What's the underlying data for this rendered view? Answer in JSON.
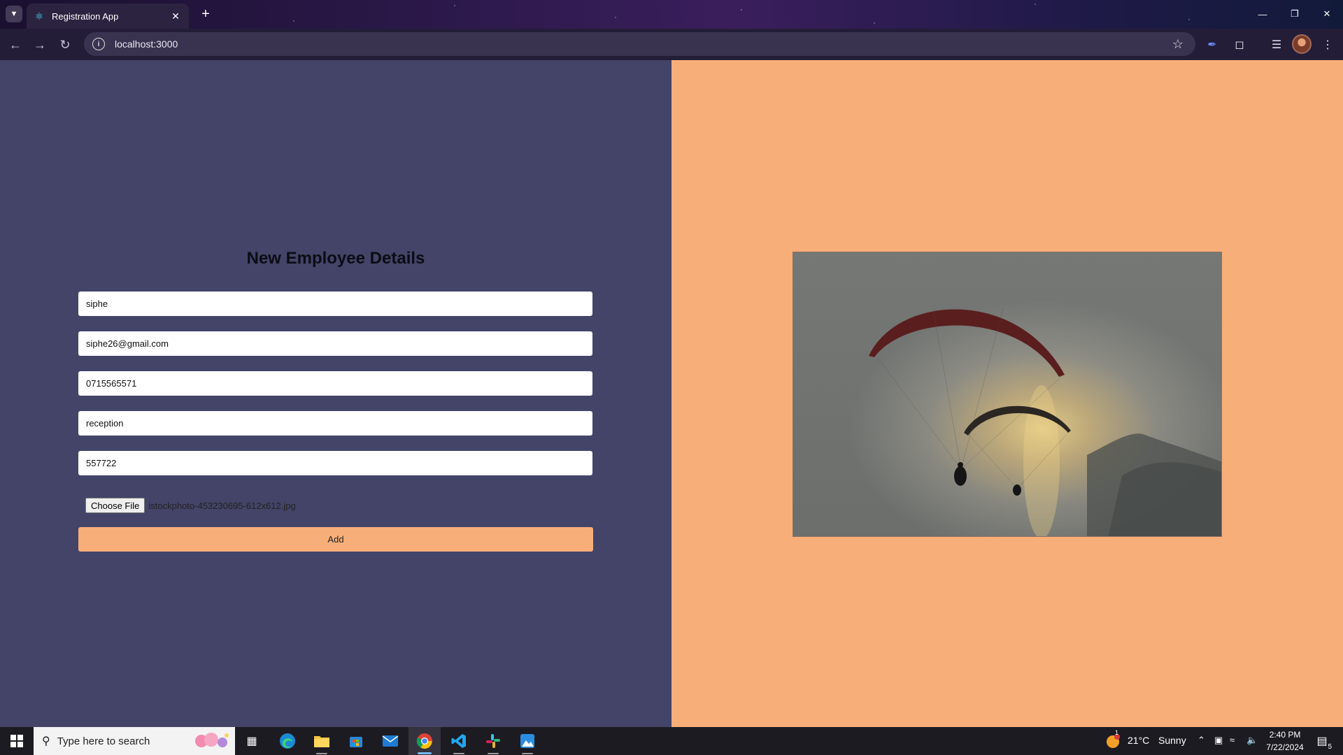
{
  "browser": {
    "tab_title": "Registration App",
    "url": "localhost:3000"
  },
  "form": {
    "title": "New Employee Details",
    "fields": [
      {
        "value": "siphe"
      },
      {
        "value": "siphe26@gmail.com"
      },
      {
        "value": "0715565571"
      },
      {
        "value": "reception"
      },
      {
        "value": "557722"
      }
    ],
    "choose_file_label": "Choose File",
    "file_name": "istockphoto-453230695-612x612.jpg",
    "add_label": "Add"
  },
  "colors": {
    "left_panel": "#434468",
    "right_panel": "#f7ae79",
    "add_button": "#f7ae79"
  },
  "taskbar": {
    "search_placeholder": "Type here to search",
    "weather_temp": "21°C",
    "weather_text": "Sunny",
    "weather_badge": "1",
    "time": "2:40 PM",
    "date": "7/22/2024",
    "notification_count": "5"
  }
}
